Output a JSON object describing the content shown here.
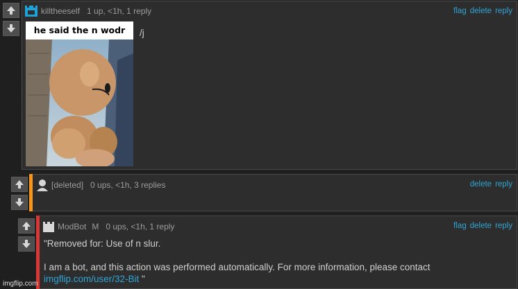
{
  "comments": [
    {
      "username": "killtheeself",
      "meta": "1 up, <1h, 1 reply",
      "actions": [
        "flag",
        "delete",
        "reply"
      ],
      "text": "/j",
      "meme_caption": "he said the n wodr"
    },
    {
      "username": "[deleted]",
      "meta": "0 ups, <1h, 3 replies",
      "actions": [
        "delete",
        "reply"
      ],
      "accent_color": "#f7941d"
    },
    {
      "username": "ModBot",
      "mod_badge": "M",
      "meta": "0 ups, <1h, 1 reply",
      "actions": [
        "flag",
        "delete",
        "reply"
      ],
      "accent_color": "#d93636",
      "line1": "\"Removed for: Use of n slur.",
      "line2": "I am a bot, and this action was performed automatically. For more information, please contact",
      "link": "imgflip.com/user/32-Bit",
      "after_link": " \""
    }
  ],
  "watermark": "imgflip.com",
  "colors": {
    "link": "#2fa6d6",
    "background": "#1f1f1f",
    "panel": "#2d2d2d"
  }
}
